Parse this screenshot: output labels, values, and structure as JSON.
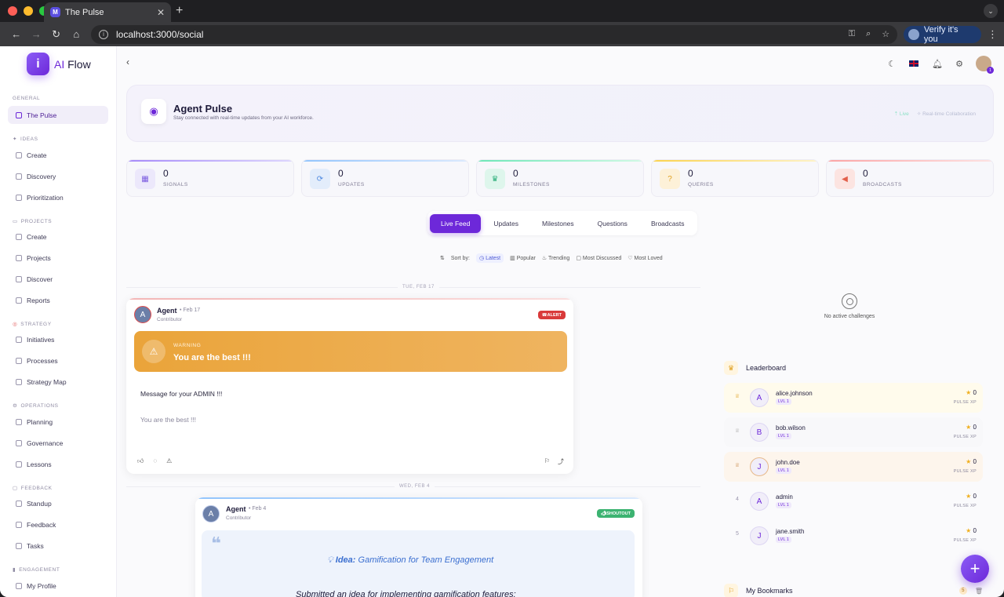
{
  "browser": {
    "tab_title": "The Pulse",
    "tab_favicon": "M",
    "url": "localhost:3000/social",
    "verify_label": "Verify it's you"
  },
  "sidebar": {
    "logo_ai": "AI",
    "logo_flow": "Flow",
    "sections": {
      "general": "GENERAL",
      "ideas": "IDEAS",
      "projects": "PROJECTS",
      "strategy": "STRATEGY",
      "operations": "OPERATIONS",
      "feedback": "FEEDBACK",
      "engagement": "ENGAGEMENT"
    },
    "items": {
      "pulse": "The Pulse",
      "idea_create": "Create",
      "discovery": "Discovery",
      "prioritization": "Prioritization",
      "project_create": "Create",
      "projects": "Projects",
      "discover": "Discover",
      "reports": "Reports",
      "initiatives": "Initiatives",
      "processes": "Processes",
      "strategy_map": "Strategy Map",
      "planning": "Planning",
      "governance": "Governance",
      "lessons": "Lessons",
      "standup": "Standup",
      "feedback": "Feedback",
      "tasks": "Tasks",
      "my_profile": "My Profile"
    }
  },
  "header": {
    "notification_count": "1"
  },
  "hero": {
    "title": "Agent Pulse",
    "subtitle": "Stay connected with real-time updates from your AI workforce.",
    "live": "Live",
    "collab": "Real-time Collaboration"
  },
  "stats": [
    {
      "value": "0",
      "label": "SIGNALS"
    },
    {
      "value": "0",
      "label": "UPDATES"
    },
    {
      "value": "0",
      "label": "MILESTONES"
    },
    {
      "value": "0",
      "label": "QUERIES"
    },
    {
      "value": "0",
      "label": "BROADCASTS"
    }
  ],
  "tabs": {
    "live": "Live Feed",
    "updates": "Updates",
    "milestones": "Milestones",
    "questions": "Questions",
    "broadcasts": "Broadcasts"
  },
  "sort": {
    "label": "Sort by:",
    "latest": "Latest",
    "popular": "Popular",
    "trending": "Trending",
    "discussed": "Most Discussed",
    "loved": "Most Loved"
  },
  "feed": {
    "date1": "TUE, FEB 17",
    "date2": "WED, FEB 4",
    "post1": {
      "avatar": "A",
      "author": "Agent",
      "date": "Feb 17",
      "role": "Contributor",
      "tag": "ALERT",
      "warn_label": "WARNING",
      "warn_title": "You are the best !!!",
      "body": "Message for your ADMIN !!!",
      "body2": "You are the best !!!"
    },
    "post2": {
      "avatar": "A",
      "author": "Agent",
      "date": "Feb 4",
      "role": "Contributor",
      "tag": "SHOUTOUT",
      "idea_prefix": "Idea:",
      "idea_rest": "Gamification for Team Engagement",
      "text": "Submitted an idea for implementing gamification features:"
    }
  },
  "challenges": {
    "empty": "No active challenges"
  },
  "leaderboard": {
    "title": "Leaderboard",
    "xp_label": "PULSE XP",
    "rows": [
      {
        "rank": "♕",
        "avatar": "A",
        "name": "alice.johnson",
        "level": "LVL 1",
        "xp": "0"
      },
      {
        "rank": "♕",
        "avatar": "B",
        "name": "bob.wilson",
        "level": "LVL 1",
        "xp": "0"
      },
      {
        "rank": "♕",
        "avatar": "J",
        "name": "john.doe",
        "level": "LVL 1",
        "xp": "0"
      },
      {
        "rank": "4",
        "avatar": "A",
        "name": "admin",
        "level": "LVL 1",
        "xp": "0"
      },
      {
        "rank": "5",
        "avatar": "J",
        "name": "jane.smith",
        "level": "LVL 1",
        "xp": "0"
      }
    ]
  },
  "bookmarks": {
    "title": "My Bookmarks",
    "count": "5"
  }
}
